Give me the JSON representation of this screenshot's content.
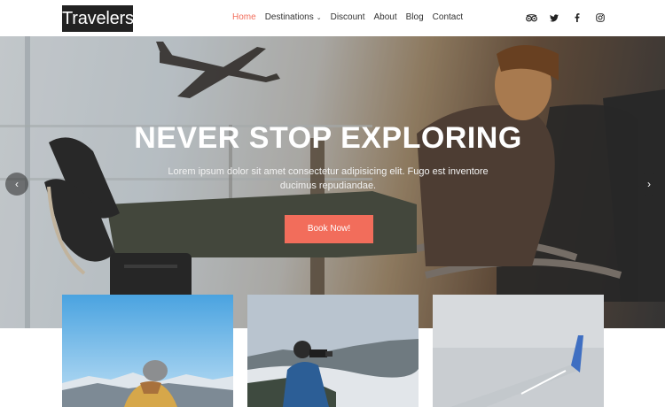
{
  "brand": {
    "logo_text": "Travelers"
  },
  "nav": {
    "items": [
      {
        "label": "Home",
        "active": true
      },
      {
        "label": "Destinations",
        "dropdown": true
      },
      {
        "label": "Discount"
      },
      {
        "label": "About"
      },
      {
        "label": "Blog"
      },
      {
        "label": "Contact"
      }
    ]
  },
  "social": [
    "tripadvisor-icon",
    "twitter-icon",
    "facebook-icon",
    "instagram-icon"
  ],
  "hero": {
    "title": "NEVER STOP EXPLORING",
    "subtitle": "Lorem ipsum dolor sit amet consectetur adipisicing elit. Fugo est inventore ducimus repudiandae.",
    "button_label": "Book Now!",
    "prev_arrow": "‹",
    "next_arrow": "›"
  },
  "colors": {
    "accent": "#f26d5b",
    "logo_bg": "#222222"
  }
}
